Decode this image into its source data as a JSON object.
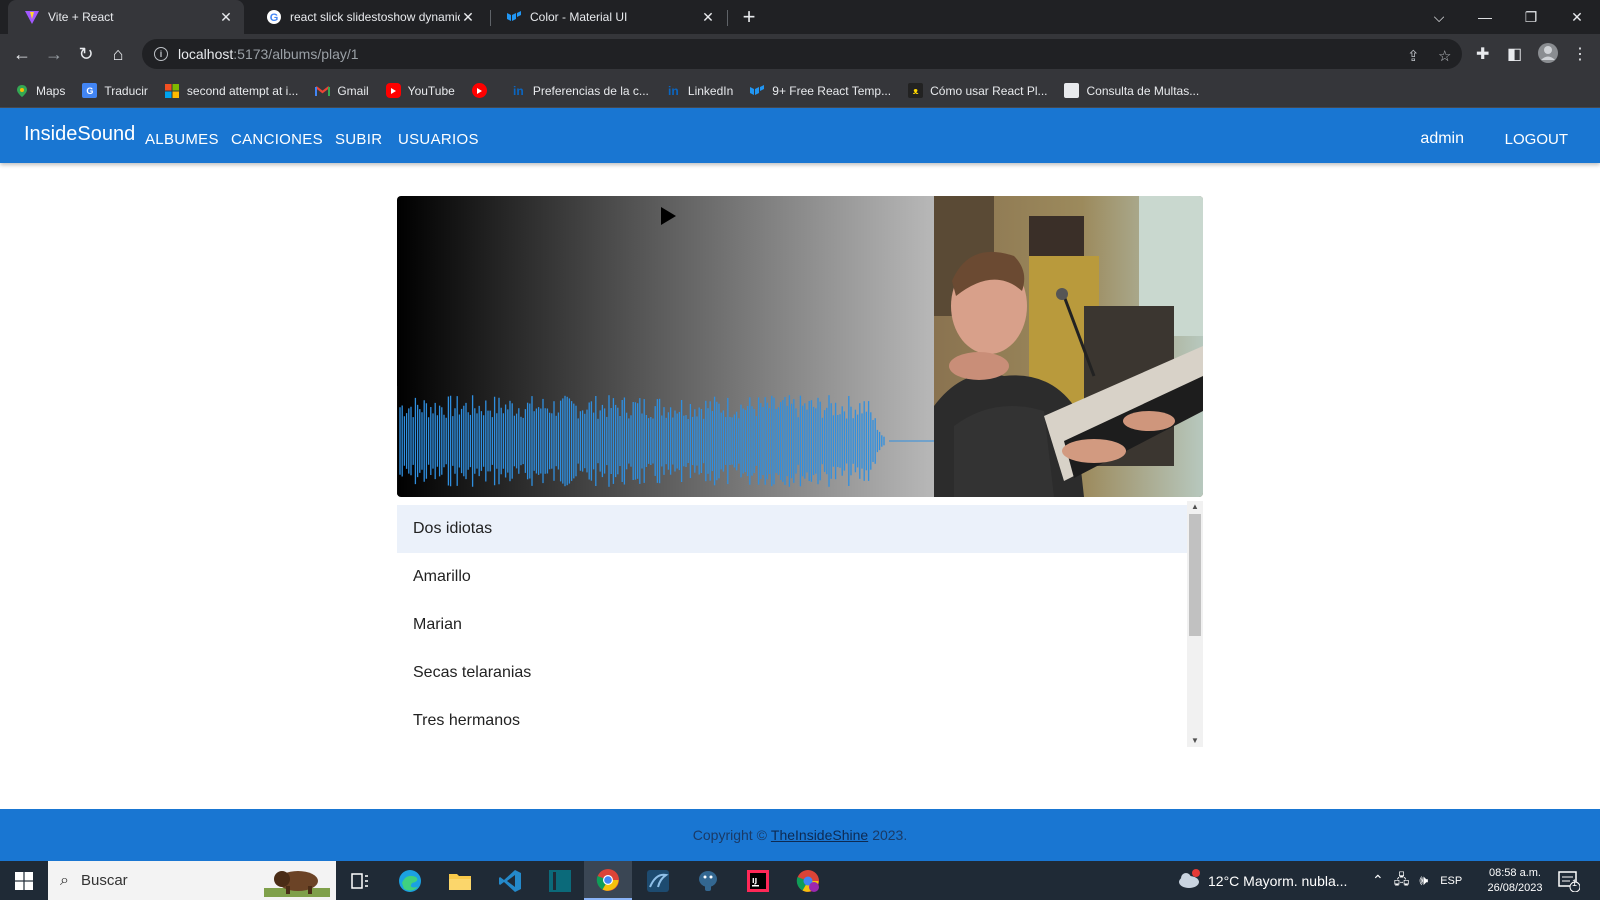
{
  "browser": {
    "tabs": [
      {
        "title": "Vite + React",
        "icon": "vite-icon",
        "active": true
      },
      {
        "title": "react slick slidestoshow dynamic",
        "icon": "google-icon",
        "active": false
      },
      {
        "title": "Color - Material UI",
        "icon": "mui-icon",
        "active": false
      }
    ],
    "new_tab": "+",
    "url_host": "localhost",
    "url_path": ":5173/albums/play/1",
    "bookmarks": [
      {
        "label": "Maps",
        "icon": "maps-icon"
      },
      {
        "label": "Traducir",
        "icon": "translate-icon"
      },
      {
        "label": "second attempt at i...",
        "icon": "microsoft-icon"
      },
      {
        "label": "Gmail",
        "icon": "gmail-icon"
      },
      {
        "label": "YouTube",
        "icon": "youtube-icon"
      },
      {
        "label": "",
        "icon": "youtube-music-icon"
      },
      {
        "label": "Preferencias de la c...",
        "icon": "linkedin-icon"
      },
      {
        "label": "LinkedIn",
        "icon": "linkedin-icon"
      },
      {
        "label": "9+ Free React Temp...",
        "icon": "mui-icon"
      },
      {
        "label": "Cómo usar React Pl...",
        "icon": "cat-icon"
      },
      {
        "label": "Consulta de Multas...",
        "icon": "document-icon"
      }
    ]
  },
  "appbar": {
    "brand": "InsideSound",
    "nav": [
      "ALBUMES",
      "CANCIONES",
      "SUBIR",
      "USUARIOS"
    ],
    "user": "admin",
    "logout": "LOGOUT",
    "color": "#1976d2"
  },
  "player": {
    "state": "paused",
    "waveform_color": "#2f8fe0",
    "progress": 0.0,
    "cover_alt": "Pianist playing keyboard"
  },
  "tracks": [
    {
      "title": "Dos idiotas",
      "selected": true
    },
    {
      "title": "Amarillo",
      "selected": false
    },
    {
      "title": "Marian",
      "selected": false
    },
    {
      "title": "Secas telaranias",
      "selected": false
    },
    {
      "title": "Tres hermanos",
      "selected": false
    }
  ],
  "footer": {
    "prefix": "Copyright ©",
    "link": "TheInsideShine",
    "suffix": "2023."
  },
  "taskbar": {
    "search_placeholder": "Buscar",
    "weather": "12°C  Mayorm. nubla...",
    "lang": "ESP",
    "time": "08:58 a.m.",
    "date": "26/08/2023",
    "notifications": "1"
  }
}
